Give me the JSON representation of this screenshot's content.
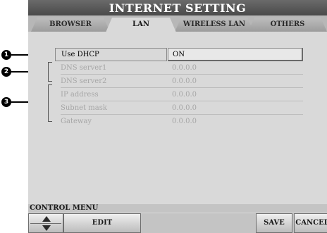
{
  "window": {
    "title": "INTERNET SETTING"
  },
  "tabs": [
    {
      "label": "BROWSER",
      "active": false
    },
    {
      "label": "LAN",
      "active": true
    },
    {
      "label": "WIRELESS LAN",
      "active": false
    },
    {
      "label": "OTHERS",
      "active": false
    }
  ],
  "callouts": [
    "1",
    "2",
    "3"
  ],
  "settings": [
    {
      "label": "Use DHCP",
      "value": "ON"
    },
    {
      "label": "DNS server1",
      "value": "0.0.0.0"
    },
    {
      "label": "DNS server2",
      "value": "0.0.0.0"
    },
    {
      "label": "IP address",
      "value": "0.0.0.0"
    },
    {
      "label": "Subnet mask",
      "value": "0.0.0.0"
    },
    {
      "label": "Gateway",
      "value": "0.0.0.0"
    }
  ],
  "control_menu": {
    "label": "CONTROL MENU",
    "arrow_icon": "up-down-arrow-icon",
    "edit_label": "EDIT",
    "save_label": "SAVE",
    "cancel_label": "CANCEL"
  },
  "colors": {
    "title_bg": "#555555",
    "panel_bg": "#d9d9d9",
    "disabled_text": "#a6a6a6",
    "callout_bg": "#000000"
  }
}
